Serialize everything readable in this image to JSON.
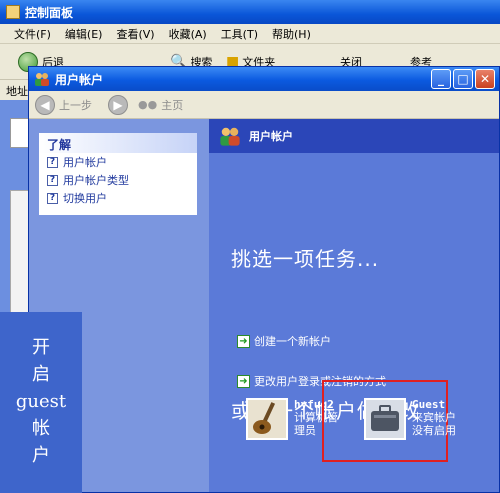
{
  "bg_window": {
    "title": "控制面板",
    "menu": [
      "文件(F)",
      "编辑(E)",
      "查看(V)",
      "收藏(A)",
      "工具(T)",
      "帮助(H)"
    ],
    "toolbar": [
      "后退",
      "搜索",
      "文件夹",
      "关闭",
      "参考"
    ],
    "address_label": "地址"
  },
  "window": {
    "title": "用户帐户",
    "nav": {
      "back": "上一步",
      "home": "主页"
    }
  },
  "learn": {
    "heading": "了解",
    "items": [
      "用户帐户",
      "用户帐户类型",
      "切换用户"
    ]
  },
  "right": {
    "header": "用户帐户",
    "task_title": "挑选一项任务...",
    "tasks": [
      "创建一个新帐户",
      "更改用户登录或注销的方式"
    ],
    "pick_title": "或挑一个帐户做更改",
    "accounts": [
      {
        "name": "hyfuq2",
        "lines": [
          "计算机管",
          "理员"
        ]
      },
      {
        "name": "Guest",
        "lines": [
          "来宾帐户",
          "没有启用"
        ]
      }
    ]
  },
  "overlay": {
    "lines": [
      "开",
      "启",
      "guest",
      "帐",
      "户"
    ]
  },
  "colors": {
    "xp_blue": "#0a53d6",
    "highlight": "#e02020"
  }
}
